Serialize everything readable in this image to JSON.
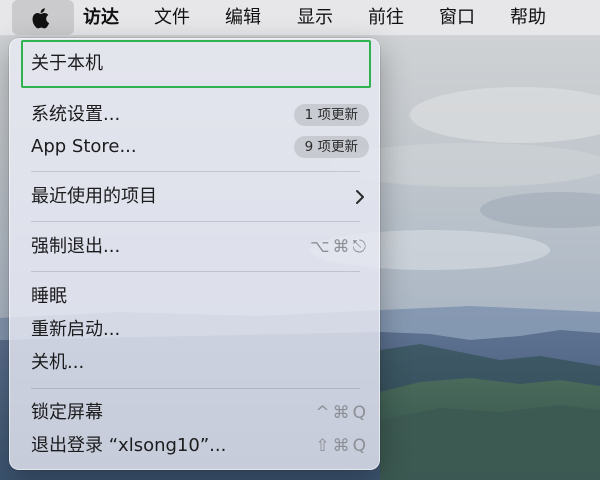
{
  "menubar": {
    "apple_icon": "apple-logo",
    "items": [
      "访达",
      "文件",
      "编辑",
      "显示",
      "前往",
      "窗口",
      "帮助"
    ]
  },
  "menu": {
    "about": "关于本机",
    "system_settings": {
      "label": "系统设置...",
      "badge": "1 项更新"
    },
    "app_store": {
      "label": "App Store...",
      "badge": "9 项更新"
    },
    "recent_items": {
      "label": "最近使用的项目",
      "icon": "chevron-right"
    },
    "force_quit": {
      "label": "强制退出...",
      "shortcut": "⌥⌘⎋"
    },
    "sleep": "睡眠",
    "restart": "重新启动...",
    "shutdown": "关机...",
    "lock_screen": {
      "label": "锁定屏幕",
      "shortcut": "^⌘Q"
    },
    "logout": {
      "label": "退出登录 “xlsong10”...",
      "shortcut": "⇧⌘Q"
    }
  },
  "colors": {
    "focus_outline": "#2fb351"
  }
}
